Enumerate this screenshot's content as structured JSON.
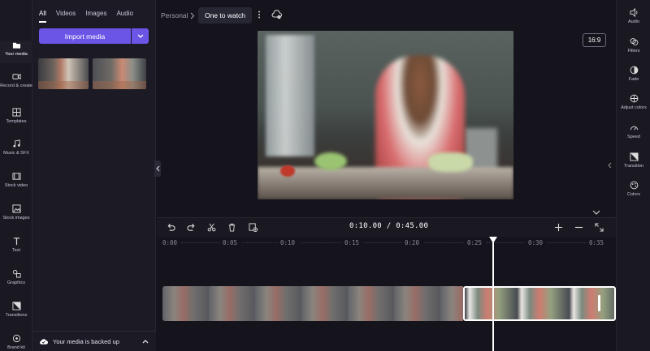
{
  "left_rail": {
    "items": [
      {
        "label": "Your media",
        "icon": "folder-icon"
      },
      {
        "label": "Record & create",
        "icon": "camera-icon"
      },
      {
        "label": "Templates",
        "icon": "templates-icon"
      },
      {
        "label": "Music & SFX",
        "icon": "music-icon"
      },
      {
        "label": "Stock video",
        "icon": "film-icon"
      },
      {
        "label": "Stock images",
        "icon": "image-icon"
      },
      {
        "label": "Text",
        "icon": "text-icon"
      },
      {
        "label": "Graphics",
        "icon": "shapes-icon"
      },
      {
        "label": "Transitions",
        "icon": "transition-icon"
      },
      {
        "label": "Brand kit",
        "icon": "brand-icon"
      }
    ]
  },
  "media_panel": {
    "tabs": [
      "All",
      "Videos",
      "Images",
      "Audio"
    ],
    "active_tab": "All",
    "import_label": "Import media",
    "backup_label": "Your media is backed up"
  },
  "header": {
    "breadcrumb": "Personal",
    "title": "One to watch"
  },
  "preview": {
    "aspect_ratio": "16:9"
  },
  "timeline": {
    "current_time": "0:10.00",
    "separator": "/",
    "total_time": "0:45.00",
    "ticks": [
      "0:00",
      "0:05",
      "0:10",
      "0:15",
      "0:20",
      "0:25",
      "0:30",
      "0:35"
    ]
  },
  "right_rail": {
    "items": [
      {
        "label": "Audio",
        "icon": "speaker-icon"
      },
      {
        "label": "Filters",
        "icon": "filters-icon"
      },
      {
        "label": "Fade",
        "icon": "fade-icon"
      },
      {
        "label": "Adjust colors",
        "icon": "adjust-icon"
      },
      {
        "label": "Speed",
        "icon": "speed-icon"
      },
      {
        "label": "Transition",
        "icon": "transition-icon"
      },
      {
        "label": "Colors",
        "icon": "palette-icon"
      }
    ]
  },
  "colors": {
    "accent": "#6a55e6",
    "background": "#15141c"
  }
}
